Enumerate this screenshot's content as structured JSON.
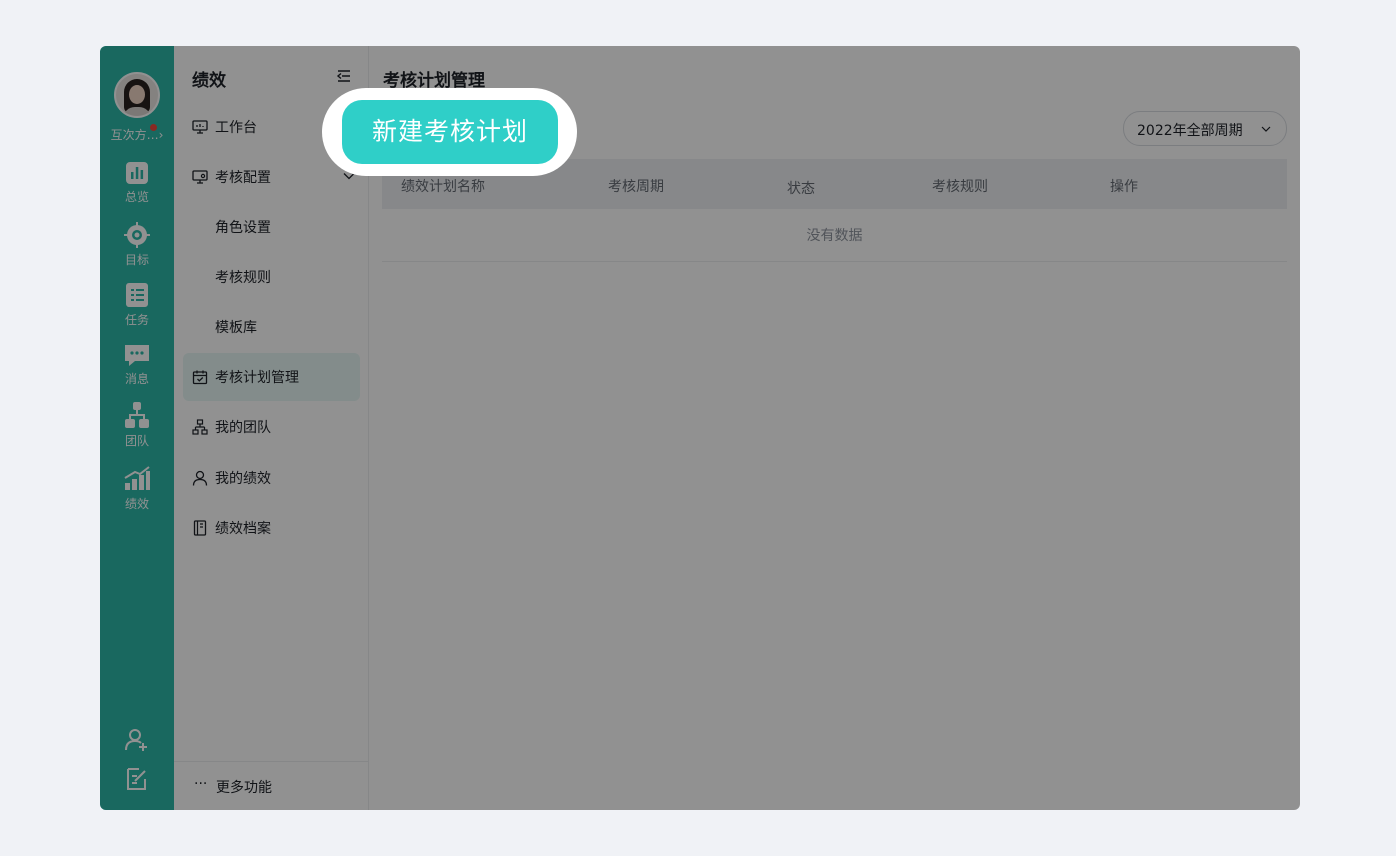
{
  "rail": {
    "username": "互次方…",
    "username_arrow": "›",
    "items": [
      {
        "label": "总览",
        "icon": "bar-chart-icon"
      },
      {
        "label": "目标",
        "icon": "target-icon"
      },
      {
        "label": "任务",
        "icon": "task-list-icon"
      },
      {
        "label": "消息",
        "icon": "message-icon"
      },
      {
        "label": "团队",
        "icon": "team-icon"
      },
      {
        "label": "绩效",
        "icon": "performance-icon"
      }
    ],
    "bottom_icons": [
      "add-member-icon",
      "edit-note-icon"
    ]
  },
  "menu": {
    "title": "绩效",
    "items": [
      {
        "label": "工作台",
        "icon": "workbench-icon"
      },
      {
        "label": "考核配置",
        "icon": "config-icon"
      },
      {
        "label": "角色设置"
      },
      {
        "label": "考核规则"
      },
      {
        "label": "模板库"
      },
      {
        "label": "考核计划管理",
        "icon": "calendar-check-icon",
        "active": true
      },
      {
        "label": "我的团队",
        "icon": "org-icon"
      },
      {
        "label": "我的绩效",
        "icon": "user-icon"
      },
      {
        "label": "绩效档案",
        "icon": "archive-icon"
      }
    ],
    "more": {
      "dots": "···",
      "label": "更多功能"
    }
  },
  "main": {
    "title": "考核计划管理",
    "period_select": "2022年全部周期",
    "table": {
      "columns": [
        "绩效计划名称",
        "考核周期",
        "状态",
        "考核规则",
        "操作"
      ],
      "empty_text": "没有数据"
    }
  },
  "spotlight": {
    "button_label": "新建考核计划"
  },
  "colors": {
    "rail": "#2db7a8",
    "accent": "#2fcfc8",
    "overlay": "rgba(0,0,0,0.43)"
  }
}
